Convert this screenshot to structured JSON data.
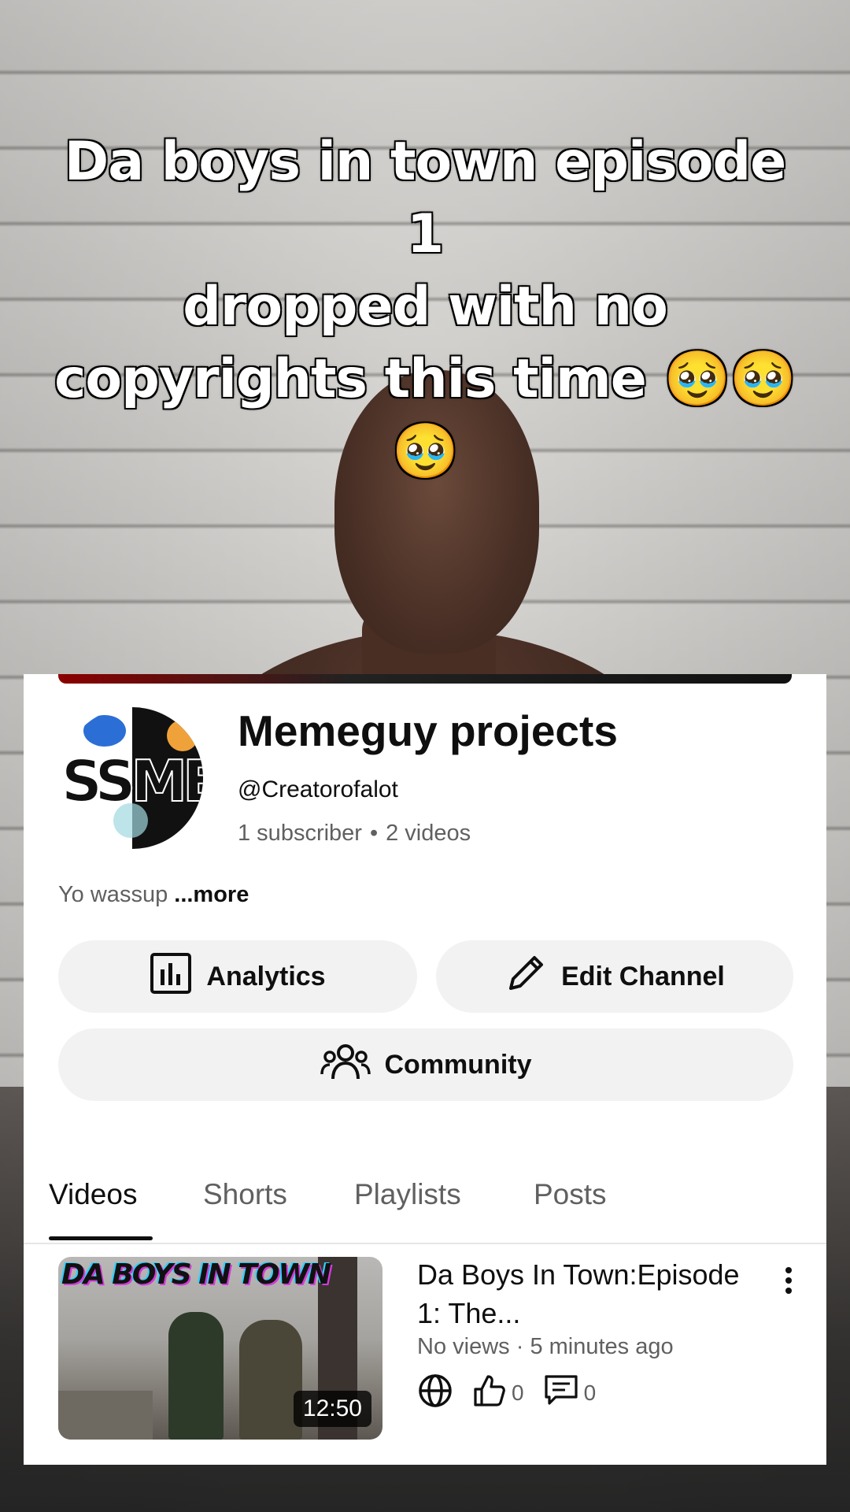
{
  "caption": {
    "line1": "Da boys in town episode 1",
    "line2": "dropped with no",
    "line3": "copyrights this time 🥹🥹",
    "line4": "🥹"
  },
  "channel": {
    "avatar_text": "SSMES",
    "name": "Memeguy projects",
    "handle": "@Creatorofalot",
    "subscribers": "1 subscriber",
    "videos_count": "2 videos",
    "description": "Yo wassup",
    "more_label": "...more"
  },
  "buttons": {
    "analytics": "Analytics",
    "edit_channel": "Edit Channel",
    "community": "Community"
  },
  "tabs": [
    "Videos",
    "Shorts",
    "Playlists",
    "Posts"
  ],
  "video": {
    "thumb_title": "DA BOYS IN TOWN",
    "duration": "12:50",
    "title": "Da Boys In Town:Episode 1: The...",
    "views": "No views",
    "age": "5 minutes ago",
    "likes": "0",
    "comments": "0"
  },
  "icons": [
    "analytics-icon",
    "pencil-icon",
    "community-icon",
    "globe-icon",
    "thumbs-up-icon",
    "comment-icon",
    "more-vertical-icon"
  ]
}
